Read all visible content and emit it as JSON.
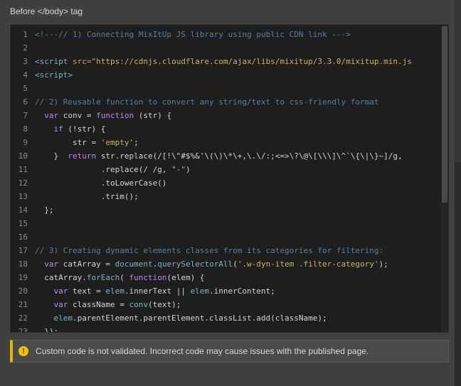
{
  "section_label": "Before </body> tag",
  "notice": {
    "icon": "warning-icon",
    "text": "Custom code is not validated. Incorrect code may cause issues with the published page."
  },
  "colors": {
    "comment": "#5c7f9a",
    "tag": "#7fb0c8",
    "attr": "#c8a062",
    "string": "#c8b36c",
    "keyword": "#b98ae8",
    "function": "#7fb0c8",
    "plain": "#d4d4d4",
    "warning": "#f5c000"
  },
  "code_lines": [
    {
      "n": "1",
      "tokens": [
        {
          "t": "<!---// 1) Connecting MixItUp JS library using public CDN link --->",
          "c": "comment"
        }
      ]
    },
    {
      "n": "2",
      "tokens": []
    },
    {
      "n": "3",
      "tokens": [
        {
          "t": "<script ",
          "c": "tag"
        },
        {
          "t": "src=",
          "c": "attr"
        },
        {
          "t": "\"https://cdnjs.cloudflare.com/ajax/libs/mixitup/3.3.0/mixitup.min.js",
          "c": "string"
        }
      ]
    },
    {
      "n": "4",
      "tokens": [
        {
          "t": "<script>",
          "c": "tag"
        }
      ]
    },
    {
      "n": "5",
      "tokens": []
    },
    {
      "n": "6",
      "tokens": [
        {
          "t": "// 2) Reusable function to convert any string/text to css-friendly format",
          "c": "comment"
        }
      ]
    },
    {
      "n": "7",
      "tokens": [
        {
          "t": "  var ",
          "c": "keyword"
        },
        {
          "t": "conv = ",
          "c": "plain"
        },
        {
          "t": "function ",
          "c": "keyword"
        },
        {
          "t": "(str) {",
          "c": "plain"
        }
      ]
    },
    {
      "n": "8",
      "tokens": [
        {
          "t": "    if ",
          "c": "keyword"
        },
        {
          "t": "(!str) {",
          "c": "plain"
        }
      ]
    },
    {
      "n": "9",
      "tokens": [
        {
          "t": "        str = ",
          "c": "plain"
        },
        {
          "t": "'empty'",
          "c": "string"
        },
        {
          "t": ";",
          "c": "plain"
        }
      ]
    },
    {
      "n": "10",
      "tokens": [
        {
          "t": "    }  ",
          "c": "plain"
        },
        {
          "t": "return ",
          "c": "keyword"
        },
        {
          "t": "str.replace(/[!\\\"#$%&'\\(\\)\\*\\+,\\.\\/:;<=>\\?\\@\\[\\\\\\]\\^`\\{\\|\\}~]/g, ",
          "c": "plain"
        }
      ]
    },
    {
      "n": "11",
      "tokens": [
        {
          "t": "              .replace(/ /g, ",
          "c": "plain"
        },
        {
          "t": "\"-\"",
          "c": "string"
        },
        {
          "t": ")",
          "c": "plain"
        }
      ]
    },
    {
      "n": "12",
      "tokens": [
        {
          "t": "              .toLowerCase()",
          "c": "plain"
        }
      ]
    },
    {
      "n": "13",
      "tokens": [
        {
          "t": "              .trim();",
          "c": "plain"
        }
      ]
    },
    {
      "n": "14",
      "tokens": [
        {
          "t": "  };",
          "c": "plain"
        }
      ]
    },
    {
      "n": "15",
      "tokens": []
    },
    {
      "n": "16",
      "tokens": []
    },
    {
      "n": "17",
      "tokens": [
        {
          "t": "// 3) Creating dynamic elements classes from its categories for filtering:",
          "c": "comment"
        }
      ]
    },
    {
      "n": "18",
      "tokens": [
        {
          "t": "  var ",
          "c": "keyword"
        },
        {
          "t": "catArray = ",
          "c": "plain"
        },
        {
          "t": "document",
          "c": "function"
        },
        {
          "t": ".",
          "c": "plain"
        },
        {
          "t": "querySelectorAll",
          "c": "function"
        },
        {
          "t": "(",
          "c": "plain"
        },
        {
          "t": "'.w-dyn-item .filter-category'",
          "c": "string"
        },
        {
          "t": ");",
          "c": "plain"
        }
      ]
    },
    {
      "n": "19",
      "tokens": [
        {
          "t": "  catArray.",
          "c": "plain"
        },
        {
          "t": "forEach",
          "c": "function"
        },
        {
          "t": "( ",
          "c": "plain"
        },
        {
          "t": "function",
          "c": "keyword"
        },
        {
          "t": "(elem) {",
          "c": "plain"
        }
      ]
    },
    {
      "n": "20",
      "tokens": [
        {
          "t": "    var ",
          "c": "keyword"
        },
        {
          "t": "text = ",
          "c": "plain"
        },
        {
          "t": "elem",
          "c": "function"
        },
        {
          "t": ".innerText || ",
          "c": "plain"
        },
        {
          "t": "elem",
          "c": "function"
        },
        {
          "t": ".innerContent;",
          "c": "plain"
        }
      ]
    },
    {
      "n": "21",
      "tokens": [
        {
          "t": "    var ",
          "c": "keyword"
        },
        {
          "t": "className = ",
          "c": "plain"
        },
        {
          "t": "conv",
          "c": "function"
        },
        {
          "t": "(text);",
          "c": "plain"
        }
      ]
    },
    {
      "n": "22",
      "tokens": [
        {
          "t": "    elem",
          "c": "function"
        },
        {
          "t": ".parentElement.parentElement.classList.add(className);",
          "c": "plain"
        }
      ]
    },
    {
      "n": "23",
      "tokens": [
        {
          "t": "  });",
          "c": "plain"
        }
      ]
    }
  ]
}
